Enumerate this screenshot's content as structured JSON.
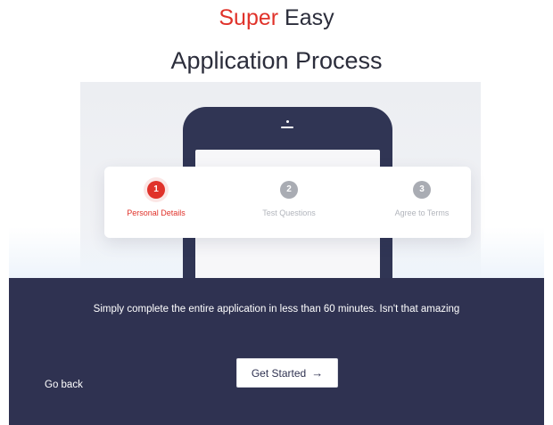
{
  "header": {
    "title_accent": "Super",
    "title_rest": " Easy",
    "subtitle": "Application Process"
  },
  "steps": [
    {
      "number": "1",
      "label": "Personal Details",
      "active": true
    },
    {
      "number": "2",
      "label": "Test Questions",
      "active": false
    },
    {
      "number": "3",
      "label": "Agree to Terms",
      "active": false
    }
  ],
  "footer": {
    "message": "Simply complete the entire application in less than 60 minutes. Isn't that amazing",
    "go_back_label": "Go back",
    "get_started_label": "Get Started",
    "get_started_icon": "arrow-right-icon"
  },
  "colors": {
    "accent": "#e0322a",
    "navy": "#2f3251",
    "step_inactive": "#a9acb3"
  }
}
